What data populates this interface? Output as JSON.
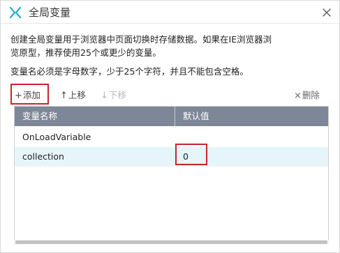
{
  "dialog": {
    "title": "全局变量",
    "logo_icon": "axure-x-logo-icon",
    "close_icon": "close-icon"
  },
  "description": {
    "line1": "创建全局变量用于浏览器中页面切换时存储数据。如果在IE浏览器浏",
    "line2": "览原型，推荐使用25个或更少的变量。",
    "line3": "变量名必须是字母数字，少于25个字符，并且不能包含空格。"
  },
  "toolbar": {
    "add": {
      "icon": "plus-icon",
      "glyph": "+",
      "label": "添加"
    },
    "move_up": {
      "icon": "arrow-up-icon",
      "glyph": "↑",
      "label": "上移"
    },
    "move_down": {
      "icon": "arrow-down-icon",
      "glyph": "↓",
      "label": "下移"
    },
    "delete": {
      "icon": "delete-x-icon",
      "glyph": "×",
      "label": "删除"
    }
  },
  "table": {
    "columns": [
      "变量名称",
      "默认值"
    ],
    "rows": [
      {
        "name": "OnLoadVariable",
        "value": ""
      },
      {
        "name": "collection",
        "value": "0"
      }
    ]
  },
  "colors": {
    "header_bg": "#7e8797",
    "selected_row_bg": "#e6f5fa",
    "highlight_border": "#c9252c",
    "logo": "#2aa7d8"
  }
}
